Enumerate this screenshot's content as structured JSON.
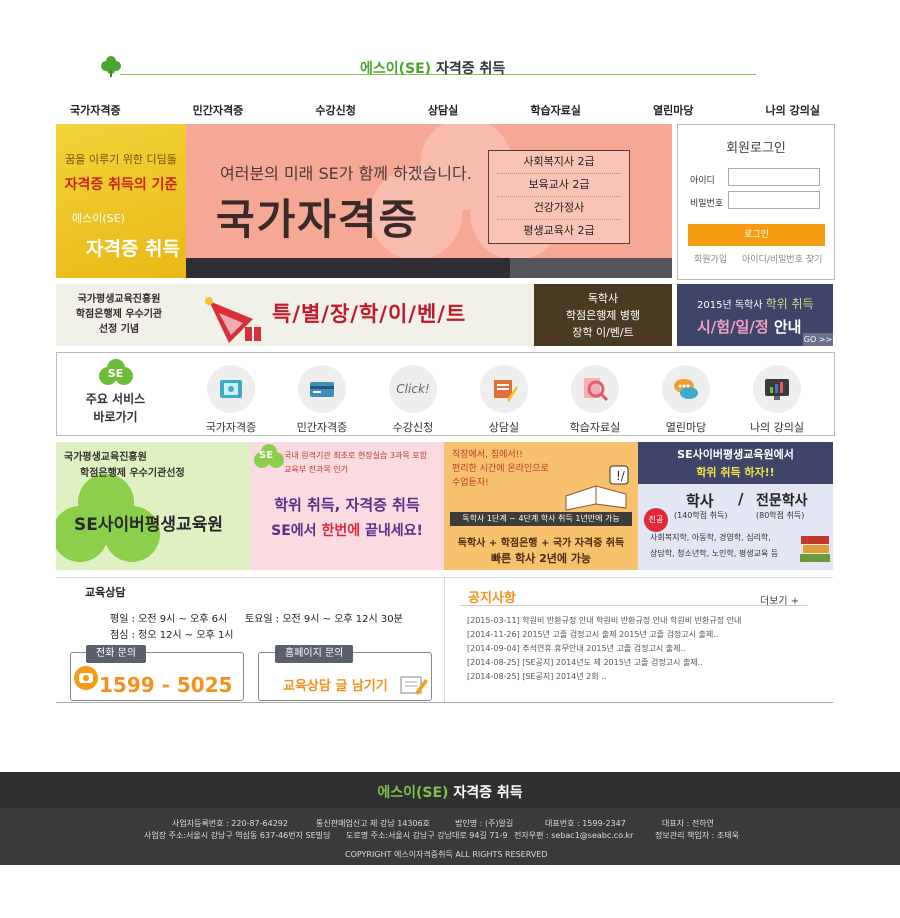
{
  "header": {
    "brand_prefix": "에스이(SE)",
    "brand_suffix": "자격증 취득"
  },
  "nav": [
    "국가자격증",
    "민간자격증",
    "수강신청",
    "상담실",
    "학습자료실",
    "열린마당",
    "나의 강의실"
  ],
  "hero": {
    "left_line1": "꿈을 이루기 위한 디딤돌",
    "left_line2": "자격증 취득의 기준",
    "left_line3": "에스이(SE)",
    "left_line4": "자격증 취득",
    "subtitle": "여러분의 미래 SE가 함께 하겠습니다.",
    "title": "국가자격증",
    "list": [
      "사회복지사 2급",
      "보육교사 2급",
      "건강가정사",
      "평생교육사 2급"
    ],
    "tab_colors": [
      "#2f2f33",
      "#2f2f33",
      "#55565c"
    ]
  },
  "login": {
    "title": "회원로그인",
    "id_label": "아이디",
    "pw_label": "비밀번호",
    "id_value": "",
    "pw_value": "",
    "button": "로그인",
    "join": "회원가입",
    "find": "아이디/비밀번호 찾기"
  },
  "promo": {
    "left_lines": [
      "국가평생교육진흥원",
      "학점은행제 우수기관",
      "선정 기념"
    ],
    "event": "특/별/장/학/이/벤/트",
    "right_lines": [
      "독학사",
      "학점은행제 병행",
      "장학 이/벤/트"
    ]
  },
  "promo2": {
    "line1_prefix": "2015년 독학사",
    "line1_highlight": "학위 취득",
    "line2_highlight": "시/험/일/정",
    "line2_suffix": "안내",
    "go": "GO >>"
  },
  "services": {
    "badge": "SE",
    "title_line1": "주요 서비스",
    "title_line2": "바로가기",
    "items": [
      {
        "label": "국가자격증",
        "icon": "book-icon",
        "color": "#3fa9c8"
      },
      {
        "label": "민간자격증",
        "icon": "card-icon",
        "color": "#3f8fb8"
      },
      {
        "label": "수강신청",
        "icon": "click-icon",
        "color": "#aaaaaa",
        "text": "Click!"
      },
      {
        "label": "상담실",
        "icon": "pencil-icon",
        "color": "#e0703a"
      },
      {
        "label": "학습자료실",
        "icon": "magnifier-icon",
        "color": "#e65a6a"
      },
      {
        "label": "열린마당",
        "icon": "speech-bubble-icon",
        "color": "#f0a030"
      },
      {
        "label": "나의 강의실",
        "icon": "chart-monitor-icon",
        "color": "#3a7ab8"
      }
    ]
  },
  "banners": {
    "b1": {
      "line1": "국가평생교육진흥원",
      "line2": "학점은행제 우수기관선정",
      "big": "SE사이버평생교육원"
    },
    "b2": {
      "badge": "SE",
      "line1": "국내 원격기관 최초로 현장실습 3과목 포함",
      "line2": "교육부 전과목 인가",
      "big1": "학위 취득, 자격증 취득",
      "big2a": "SE에서",
      "big2b": "한번에",
      "big2c": "끝내세요!"
    },
    "b3": {
      "hand1": "직장에서, 집에서!!",
      "hand2": "편리한 시간에 온라인으로",
      "hand3": "수업듣자!",
      "strip": "독학사 1단계 ~ 4단계 학사 취득 1년만에 가능",
      "big1": "독학사 + 학점은행 + 국가 자격증 취득",
      "big2": "빠른 학사 2년에 가능"
    },
    "b4": {
      "top1": "SE사이버평생교육원에서",
      "top2": "학위 취득 하자!!",
      "badge": "전공",
      "deg1": "학사",
      "deg1_sub": "(140학점 취득)",
      "slash": "/",
      "deg2": "전문학사",
      "deg2_sub": "(80학점 취득)",
      "majors1": "사회복지학, 아동학, 경영학, 심리학,",
      "majors2": "상담학, 청소년학, 노인학, 평생교육 등"
    }
  },
  "consult": {
    "title": "교육상담",
    "weekday": "평일 : 오전 9시 ~ 오후 6시",
    "saturday": "토요일 : 오전 9시 ~ 오후 12시 30분",
    "lunch": "점심 : 정오 12시 ~ 오후 1시",
    "phone_tag": "전화 문의",
    "phone": "1599 - 5025",
    "web_tag": "홈페이지 문의",
    "web_text": "교육상담 글 남기기"
  },
  "notice": {
    "title": "공지사항",
    "more": "더보기 +",
    "items": [
      "[2015-03-11] 학원비 반환규정 안내 학원비 반환규정 안내 학원비 반환규정 안내",
      "[2014-11-26] 2015년 고졸 검정고시 출제 2015년 고졸 검정고시 출제..",
      "[2014-09-04] 추석연휴 휴무안내 2015년 고졸 검정고시 출제..",
      "[2014-08-25] [SE공지] 2014년도 제 2015년 고졸 검정고시 출제..",
      "[2014-08-25] [SE공지] 2014년 2회 .."
    ]
  },
  "footer": {
    "brand_prefix": "에스이(SE)",
    "brand_suffix": "자격증 취득",
    "biz_no": "사업자등록번호 : 220-87-64292",
    "mail_order": "통신판매업신고 제 강남 14306호",
    "corp": "법인명 : (주)알길",
    "tel": "대표번호 : 1599-2347",
    "ceo": "대표자 : 전하연",
    "address": "사업장 주소:서울시 강남구 역삼동 637-46번지 SE빌딩",
    "road": "도로명 주소:서울시 강남구 강남대로 94길 71-9",
    "email": "전자우편 : sebac1@seabc.co.kr",
    "privacy": "정보관리 책임자 : 조태욱",
    "copyright": "COPYRIGHT   에스이자격증취득   ALL RIGHTS RESERVED"
  }
}
